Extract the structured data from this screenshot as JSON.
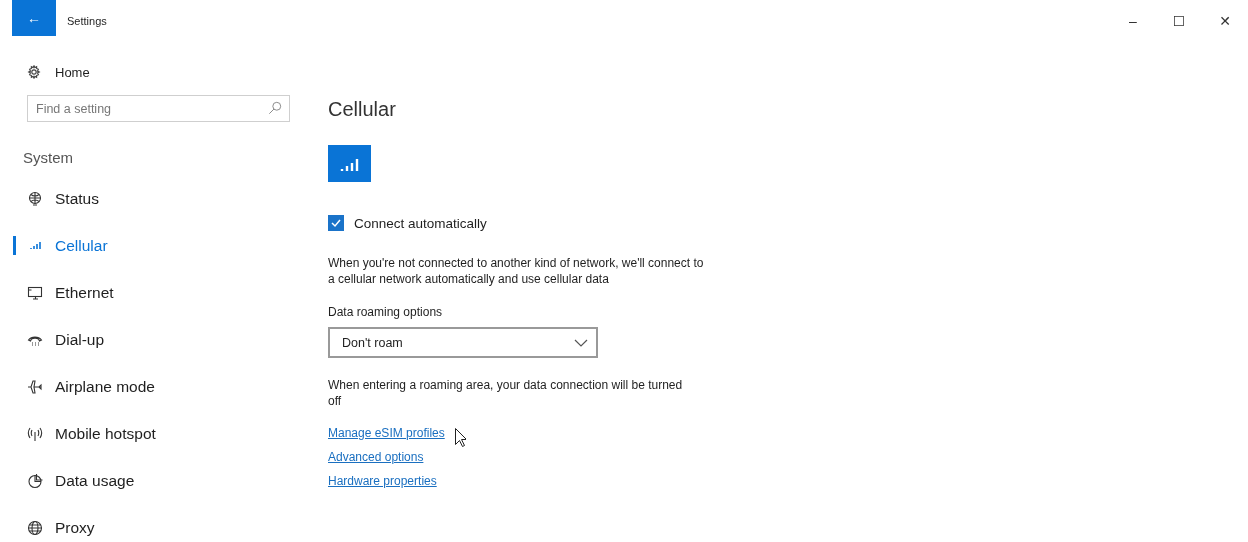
{
  "window": {
    "title": "Settings",
    "back_button": "←",
    "controls": [
      "–",
      "☐",
      "✕"
    ]
  },
  "sidebar": {
    "home": "Home",
    "search": {
      "placeholder": "Find a setting"
    },
    "section": "System",
    "items": [
      {
        "label": "Status",
        "selected": false
      },
      {
        "label": "Cellular",
        "selected": true
      },
      {
        "label": "Ethernet",
        "selected": false
      },
      {
        "label": "Dial-up",
        "selected": false
      },
      {
        "label": "Airplane mode",
        "selected": false
      },
      {
        "label": "Mobile hotspot",
        "selected": false
      },
      {
        "label": "Data usage",
        "selected": false
      },
      {
        "label": "Proxy",
        "selected": false
      }
    ]
  },
  "content": {
    "title": "Cellular",
    "connect": {
      "label": "Connect automatically",
      "checked": true
    },
    "connect_description": "When you're not connected to another kind of network, we'll connect to a cellular network automatically and use cellular data",
    "roaming_label": "Data roaming options",
    "roaming_dropdown": {
      "value": "Don't roam"
    },
    "roaming_description": "When entering a roaming area, your data connection will be turned off",
    "links": [
      "Manage eSIM profiles",
      "Advanced options",
      "Hardware properties"
    ]
  }
}
